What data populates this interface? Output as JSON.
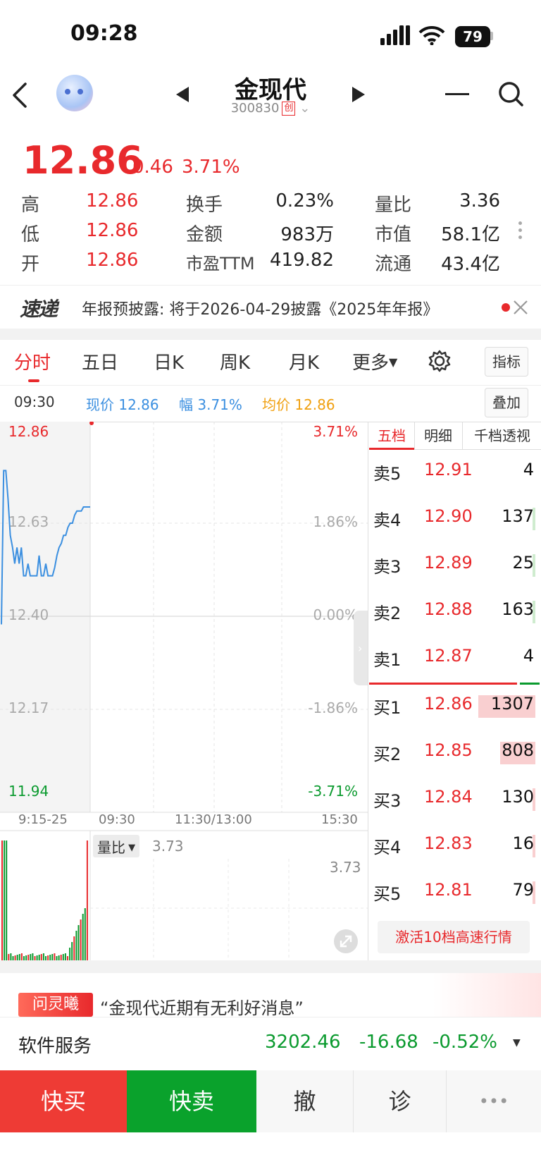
{
  "status": {
    "time": "09:28",
    "battery": "79"
  },
  "header": {
    "title": "金现代",
    "code": "300830",
    "board_tag": "创"
  },
  "quote": {
    "price": "12.86",
    "change": "0.46",
    "change_pct": "3.71%",
    "stats": [
      [
        {
          "label": "高",
          "value": "12.86"
        },
        {
          "label": "换手",
          "value": "0.23%"
        },
        {
          "label": "量比",
          "value": "3.36"
        }
      ],
      [
        {
          "label": "低",
          "value": "12.86"
        },
        {
          "label": "金额",
          "value": "983万"
        },
        {
          "label": "市值",
          "value": "58.1亿"
        }
      ],
      [
        {
          "label": "开",
          "value": "12.86"
        },
        {
          "label": "市盈TTM",
          "value": "419.82"
        },
        {
          "label": "流通",
          "value": "43.4亿"
        }
      ]
    ]
  },
  "news": {
    "logo": "速递",
    "text": "年报预披露: 将于2026-04-29披露《2025年年报》"
  },
  "tabs": [
    "分时",
    "五日",
    "日K",
    "周K",
    "月K",
    "更多"
  ],
  "indicator_btn": "指标",
  "overlay_btn": "叠加",
  "info_bar": {
    "time": "09:30",
    "price_label": "现价",
    "price": "12.86",
    "pct_label": "幅",
    "pct": "3.71%",
    "avg_label": "均价",
    "avg": "12.86"
  },
  "chart_data": {
    "type": "line",
    "y_left_ticks": [
      "12.86",
      "12.63",
      "12.40",
      "12.17",
      "11.94"
    ],
    "y_right_ticks": [
      "3.71%",
      "1.86%",
      "0.00%",
      "-1.86%",
      "-3.71%"
    ],
    "x_ticks": [
      "9:15-25",
      "09:30",
      "11:30/13:00",
      "15:30"
    ],
    "ylim": [
      11.94,
      12.86
    ],
    "series": [
      {
        "x": [
          0,
          1,
          2,
          3,
          4,
          5,
          6,
          7,
          8,
          9,
          10,
          11,
          12,
          13,
          14,
          15,
          16,
          17,
          18,
          19,
          20,
          21,
          22,
          23,
          24,
          25,
          26,
          27,
          28,
          29,
          30,
          31,
          32,
          33,
          34,
          35,
          36,
          37,
          38,
          39,
          40
        ],
        "values": [
          12.38,
          12.76,
          12.76,
          12.69,
          12.6,
          12.57,
          12.53,
          12.57,
          12.53,
          12.57,
          12.5,
          12.5,
          12.53,
          12.5,
          12.5,
          12.5,
          12.5,
          12.55,
          12.5,
          12.5,
          12.53,
          12.5,
          12.5,
          12.5,
          12.52,
          12.55,
          12.57,
          12.58,
          12.6,
          12.6,
          12.62,
          12.63,
          12.63,
          12.65,
          12.66,
          12.66,
          12.66,
          12.67,
          12.67,
          12.67,
          12.67
        ]
      }
    ]
  },
  "volume": {
    "label": "量比",
    "value": "3.73",
    "right_value": "3.73"
  },
  "orderbook": {
    "tabs": [
      "五档",
      "明细",
      "千档透视"
    ],
    "sell": [
      {
        "label": "卖5",
        "price": "12.91",
        "vol": "4",
        "fill": 0.0
      },
      {
        "label": "卖4",
        "price": "12.90",
        "vol": "137",
        "fill": 0.04
      },
      {
        "label": "卖3",
        "price": "12.89",
        "vol": "25",
        "fill": 0.02
      },
      {
        "label": "卖2",
        "price": "12.88",
        "vol": "163",
        "fill": 0.05
      },
      {
        "label": "卖1",
        "price": "12.87",
        "vol": "4",
        "fill": 0.0
      }
    ],
    "buy": [
      {
        "label": "买1",
        "price": "12.86",
        "vol": "1307",
        "fill": 0.97
      },
      {
        "label": "买2",
        "price": "12.85",
        "vol": "808",
        "fill": 0.6
      },
      {
        "label": "买3",
        "price": "12.84",
        "vol": "130",
        "fill": 0.05
      },
      {
        "label": "买4",
        "price": "12.83",
        "vol": "16",
        "fill": 0.02
      },
      {
        "label": "买5",
        "price": "12.81",
        "vol": "79",
        "fill": 0.03
      }
    ],
    "activate": "激活10档高速行情"
  },
  "ai_bar": {
    "badge": "问灵曦",
    "text": "“金现代近期有无利好消息”"
  },
  "sector": {
    "name": "软件服务",
    "index": "3202.46",
    "change": "-16.68",
    "pct": "-0.52%"
  },
  "actions": {
    "buy": "快买",
    "sell": "快卖",
    "cancel": "撤",
    "diag": "诊",
    "more": "•••"
  },
  "colors": {
    "up": "#e8292c",
    "down": "#0a9a2e",
    "line": "#3b8fe0",
    "avg": "#f0a010"
  }
}
